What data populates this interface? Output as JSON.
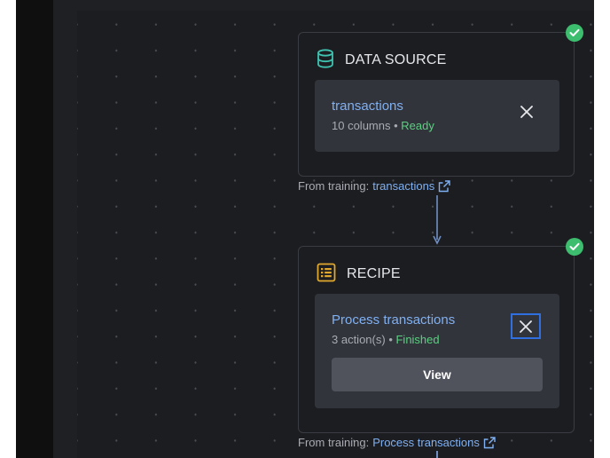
{
  "nodes": {
    "data_source": {
      "title": "DATA SOURCE",
      "icon": "database-icon",
      "status": "complete",
      "item": {
        "name": "transactions",
        "meta": "10 columns",
        "separator": " • ",
        "status": "Ready"
      },
      "from_training": {
        "label": "From training:",
        "link": "transactions"
      }
    },
    "recipe": {
      "title": "RECIPE",
      "icon": "recipe-list-icon",
      "status": "complete",
      "item": {
        "name": "Process transactions",
        "meta": "3 action(s)",
        "separator": " • ",
        "status": "Finished",
        "view_label": "View"
      },
      "from_training": {
        "label": "From training:",
        "link": "Process transactions"
      }
    }
  },
  "colors": {
    "canvas": "#1c1d21",
    "card": "#32343c",
    "link": "#7fb0f2",
    "success": "#3dbd6e",
    "recipe_icon": "#e0a92e",
    "source_icon": "#3fc2b0",
    "focus": "#2f6fe0"
  }
}
